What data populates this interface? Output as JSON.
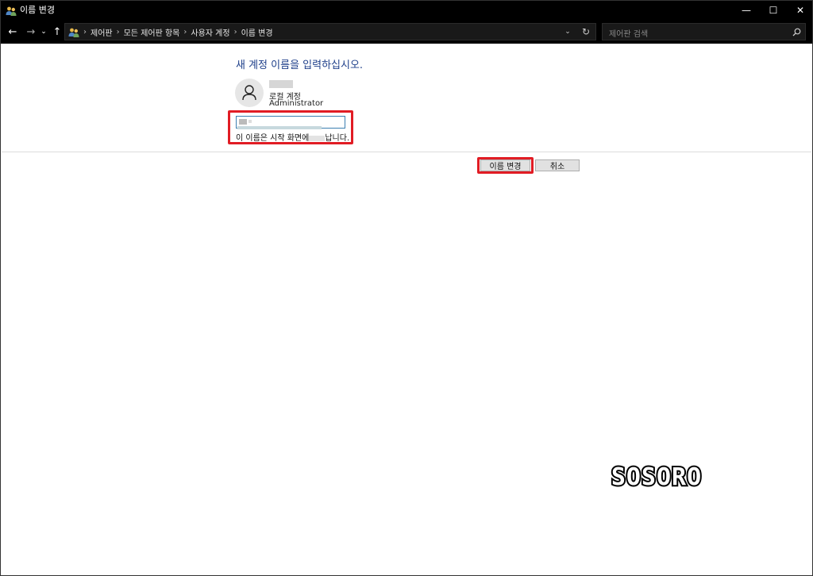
{
  "window": {
    "title": "이름 변경",
    "minimize_glyph": "—",
    "maximize_glyph": "☐",
    "close_glyph": "✕"
  },
  "nav": {
    "back_glyph": "←",
    "forward_glyph": "→",
    "recent_glyph": "⌄",
    "up_glyph": "↑",
    "breadcrumbs": [
      "제어판",
      "모든 제어판 항목",
      "사용자 계정",
      "이름 변경"
    ],
    "separator": "›",
    "dropdown_glyph": "⌄",
    "refresh_glyph": "↻"
  },
  "search": {
    "placeholder": "제어판 검색"
  },
  "content": {
    "heading": "새 계정 이름을 입력하십시오.",
    "account_type": "로컬 계정",
    "account_role": "Administrator",
    "hint_prefix": "이 이름은 시작 화면에",
    "hint_suffix": "납니다."
  },
  "buttons": {
    "change_label": "이름 변경",
    "cancel_label": "취소"
  },
  "watermark": {
    "text": "SOSORO"
  },
  "icons": {
    "title": "users-icon",
    "address": "users-icon",
    "avatar": "user-avatar-icon",
    "search": "search-icon"
  },
  "colors": {
    "heading": "#1e3f8a",
    "highlight": "#e11c24",
    "titlebar": "#000000"
  }
}
